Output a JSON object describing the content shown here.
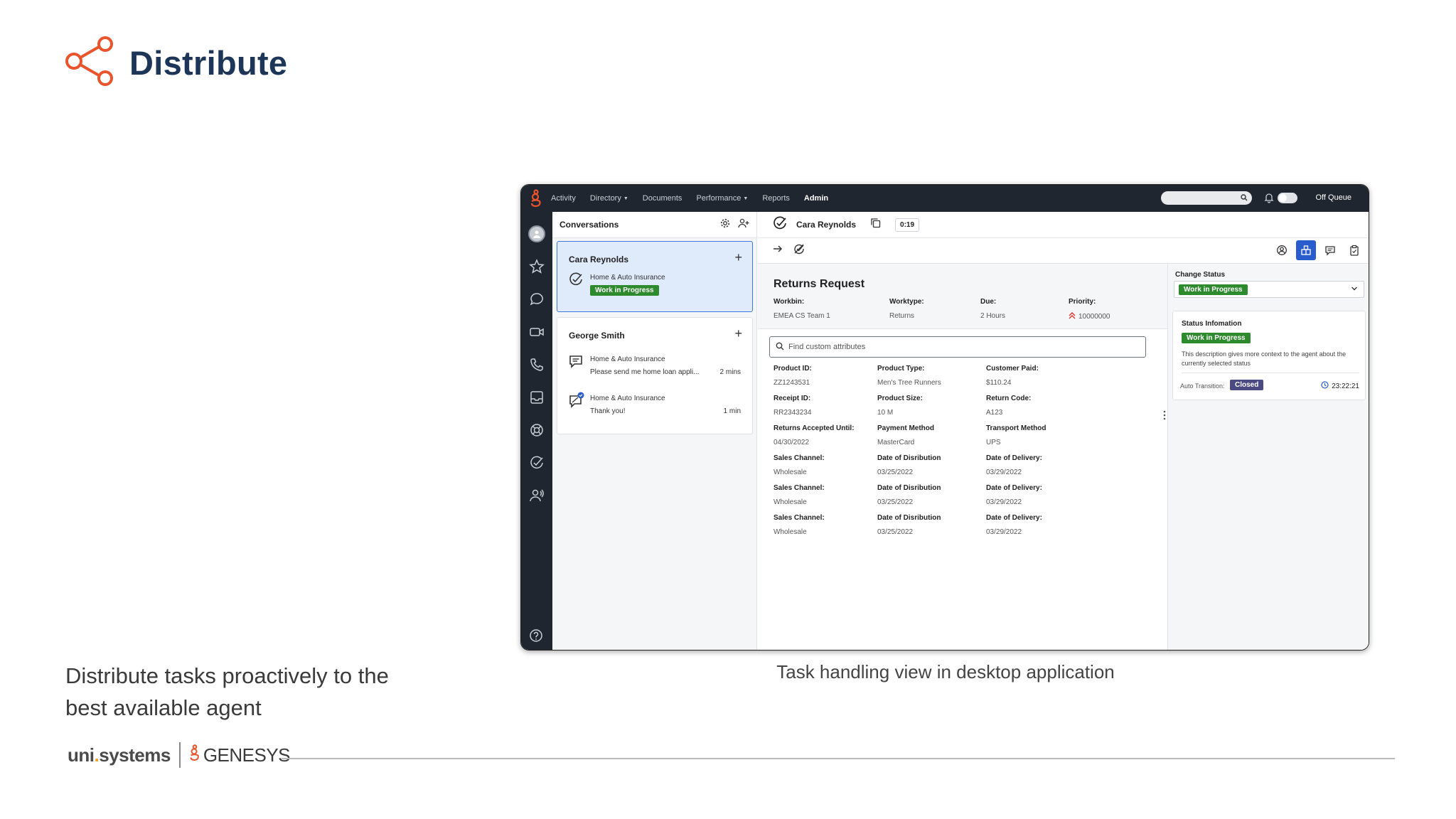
{
  "slide": {
    "title": "Distribute",
    "caption_left": "Distribute tasks proactively to the best available agent",
    "caption_center": "Task handling view in desktop application",
    "footer": {
      "brand_uni_a": "uni",
      "brand_uni_dot": ".",
      "brand_uni_b": "systems",
      "brand_genesys": "GENESYS"
    },
    "colors": {
      "title": "#1d3557",
      "accent": "#e8542c"
    }
  },
  "app": {
    "nav": [
      {
        "label": "Activity"
      },
      {
        "label": "Directory",
        "dropdown": true
      },
      {
        "label": "Documents"
      },
      {
        "label": "Performance",
        "dropdown": true
      },
      {
        "label": "Reports"
      },
      {
        "label": "Admin",
        "active": true
      }
    ],
    "queue_label": "Off Queue",
    "rail_icons": [
      "avatar",
      "star-icon",
      "chat-icon",
      "video-icon",
      "phone-icon",
      "inbox-icon",
      "lifebuoy-icon",
      "task-check-icon",
      "contacts-icon",
      "help-icon"
    ],
    "conversations": {
      "title": "Conversations",
      "cards": [
        {
          "name": "Cara Reynolds",
          "line1": "Home & Auto Insurance",
          "status": "Work in Progress",
          "selected": true
        },
        {
          "name": "George Smith",
          "items": [
            {
              "line1": "Home & Auto Insurance",
              "line2": "Please send me home loan appli...",
              "time": "2 mins"
            },
            {
              "line1": "Home & Auto Insurance",
              "line2": "Thank you!",
              "time": "1 min"
            }
          ]
        }
      ]
    },
    "main": {
      "name": "Cara Reynolds",
      "timer": "0:19",
      "task_title": "Returns Request",
      "meta": [
        {
          "label": "Workbin:",
          "value": "EMEA CS Team 1"
        },
        {
          "label": "Worktype:",
          "value": "Returns"
        },
        {
          "label": "Due:",
          "value": "2 Hours"
        },
        {
          "label": "Priority:",
          "value": "10000000"
        }
      ],
      "search_placeholder": "Find custom attributes",
      "attributes": [
        {
          "label": "Product ID:",
          "value": "ZZ1243531"
        },
        {
          "label": "Product Type:",
          "value": "Men's Tree Runners"
        },
        {
          "label": "Customer Paid:",
          "value": "$110.24"
        },
        {
          "label": "Receipt ID:",
          "value": "RR2343234"
        },
        {
          "label": "Product Size:",
          "value": "10 M"
        },
        {
          "label": "Return Code:",
          "value": "A123"
        },
        {
          "label": "Returns Accepted Until:",
          "value": "04/30/2022"
        },
        {
          "label": "Payment Method",
          "value": "MasterCard"
        },
        {
          "label": "Transport Method",
          "value": "UPS"
        },
        {
          "label": "Sales Channel:",
          "value": "Wholesale"
        },
        {
          "label": "Date of Disribution",
          "value": "03/25/2022"
        },
        {
          "label": "Date of Delivery:",
          "value": "03/29/2022"
        },
        {
          "label": "Sales Channel:",
          "value": "Wholesale"
        },
        {
          "label": "Date of Disribution",
          "value": "03/25/2022"
        },
        {
          "label": "Date of Delivery:",
          "value": "03/29/2022"
        },
        {
          "label": "Sales Channel:",
          "value": "Wholesale"
        },
        {
          "label": "Date of Disribution",
          "value": "03/25/2022"
        },
        {
          "label": "Date of Delivery:",
          "value": "03/29/2022"
        }
      ]
    },
    "status_panel": {
      "change_status_label": "Change Status",
      "selected_status": "Work in Progress",
      "info_title": "Status Infomation",
      "info_status": "Work in Progress",
      "info_description": "This description gives more context to the agent about the currently selected status",
      "auto_transition_label": "Auto Transition:",
      "auto_transition_status": "Closed",
      "auto_transition_time": "23:22:21"
    },
    "colors": {
      "topbar": "#20262f",
      "green": "#2d8a2d",
      "purple": "#4b4a83",
      "blue": "#2a5dcc",
      "selected_card": "#dfeafb"
    }
  }
}
